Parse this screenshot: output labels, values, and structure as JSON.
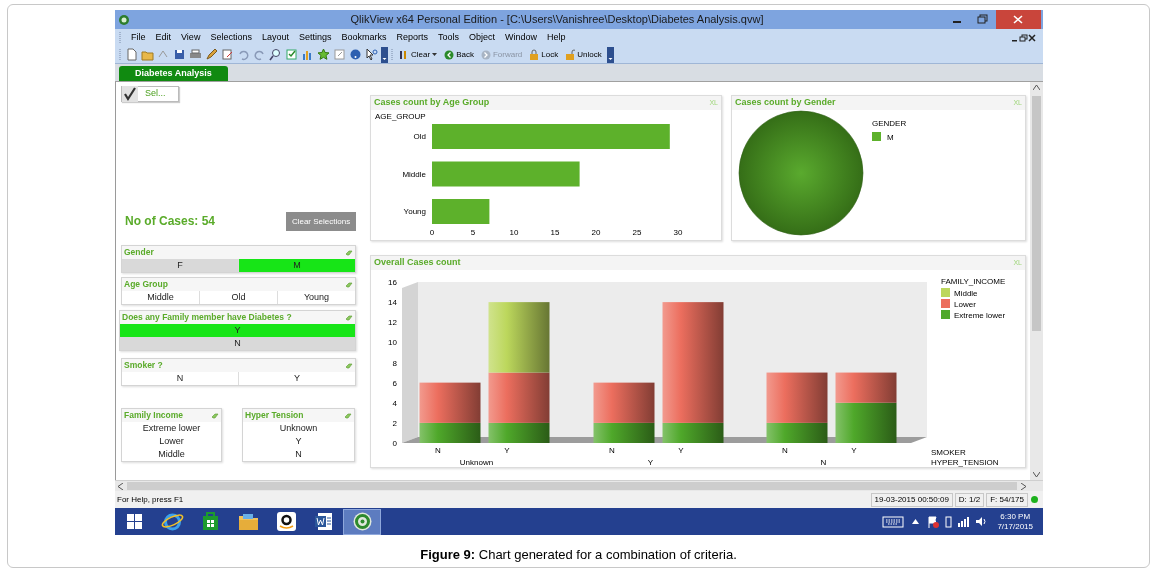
{
  "window": {
    "title": "QlikView x64 Personal Edition - [C:\\Users\\Vanishree\\Desktop\\Diabetes Analysis.qvw]"
  },
  "menu": [
    "File",
    "Edit",
    "View",
    "Selections",
    "Layout",
    "Settings",
    "Bookmarks",
    "Reports",
    "Tools",
    "Object",
    "Window",
    "Help"
  ],
  "toolbar": {
    "buttons": [
      {
        "kind": "clear",
        "label": "Clear",
        "disabled": false
      },
      {
        "kind": "back",
        "label": "Back",
        "disabled": false
      },
      {
        "kind": "forward",
        "label": "Forward",
        "disabled": true
      },
      {
        "kind": "lock",
        "label": "Lock",
        "disabled": false
      },
      {
        "kind": "unlock",
        "label": "Unlock",
        "disabled": false
      }
    ]
  },
  "tabs": [
    {
      "label": "Diabetes Analysis",
      "selected": true
    }
  ],
  "sheet": {
    "selections_button": "Sel...",
    "case_count": "No of Cases: 54",
    "clear_button": "Clear Selections",
    "listboxes": [
      {
        "title": "Gender",
        "kind": "row",
        "values": [
          {
            "label": "F",
            "selected": false,
            "excluded": true
          },
          {
            "label": "M",
            "selected": true,
            "excluded": false
          }
        ]
      },
      {
        "title": "Age Group",
        "kind": "row",
        "values": [
          {
            "label": "Middle",
            "selected": false,
            "excluded": false
          },
          {
            "label": "Old",
            "selected": false,
            "excluded": false
          },
          {
            "label": "Young",
            "selected": false,
            "excluded": false
          }
        ]
      },
      {
        "title": "Does any Family member have Diabetes ?",
        "kind": "column",
        "values": [
          {
            "label": "Y",
            "selected": true,
            "excluded": false
          },
          {
            "label": "N",
            "selected": false,
            "excluded": true
          }
        ]
      },
      {
        "title": "Smoker ?",
        "kind": "row",
        "values": [
          {
            "label": "N",
            "selected": false,
            "excluded": false
          },
          {
            "label": "Y",
            "selected": false,
            "excluded": false
          }
        ]
      },
      {
        "title": "Family Income",
        "kind": "column",
        "values": [
          {
            "label": "Extreme lower",
            "selected": false,
            "excluded": false
          },
          {
            "label": "Lower",
            "selected": false,
            "excluded": false
          },
          {
            "label": "Middle",
            "selected": false,
            "excluded": false
          }
        ]
      },
      {
        "title": "Hyper Tension",
        "kind": "column",
        "values": [
          {
            "label": "Unknown",
            "selected": false,
            "excluded": false
          },
          {
            "label": "Y",
            "selected": false,
            "excluded": false
          },
          {
            "label": "N",
            "selected": false,
            "excluded": false
          }
        ]
      }
    ],
    "charts": [
      {
        "export_label": "XL",
        "chart_data": {
          "type": "bar",
          "orientation": "horizontal",
          "title": "Cases count by Age Group",
          "ylabel": "AGE_GROUP",
          "categories": [
            "Old",
            "Middle",
            "Young"
          ],
          "values": [
            29,
            18,
            7
          ],
          "xlim": [
            0,
            30
          ],
          "xticks": [
            0,
            5,
            10,
            15,
            20,
            25,
            30
          ]
        }
      },
      {
        "export_label": "XL",
        "legend_title": "GENDER",
        "chart_data": {
          "type": "pie",
          "title": "Cases count by Gender",
          "categories": [
            "M"
          ],
          "values": [
            100
          ],
          "legend": true
        }
      },
      {
        "export_label": "XL",
        "legend_title": "FAMILY_INCOME",
        "x_groups": [
          "Unknown",
          "Y",
          "N"
        ],
        "group_axis_label": "HYPER_TENSION",
        "chart_data": {
          "type": "bar",
          "stacked": true,
          "title": "Overall Cases count",
          "xlabel": "SMOKER",
          "categories": [
            "N",
            "Y",
            "N",
            "Y",
            "N",
            "Y"
          ],
          "ylim": [
            0,
            16
          ],
          "yticks": [
            0,
            2,
            4,
            6,
            8,
            10,
            12,
            14,
            16
          ],
          "legend": true,
          "series": [
            {
              "name": "Extreme lower",
              "color": "#4fa82a",
              "values": [
                2,
                2,
                2,
                2,
                2,
                4
              ]
            },
            {
              "name": "Lower",
              "color": "#ec6e5e",
              "values": [
                4,
                5,
                4,
                12,
                5,
                3
              ]
            },
            {
              "name": "Middle",
              "color": "#bcd75c",
              "values": [
                null,
                7,
                null,
                null,
                null,
                null
              ]
            }
          ]
        }
      }
    ]
  },
  "status_bar": {
    "help": "For Help, press F1",
    "timestamp": "19-03-2015 00:50:09",
    "documents": "D: 1/2",
    "fields": "F: 54/175"
  },
  "taskbar": {
    "apps": [
      {
        "kind": "start",
        "selected": false
      },
      {
        "kind": "browser",
        "selected": false
      },
      {
        "kind": "store",
        "selected": false
      },
      {
        "kind": "files",
        "selected": false
      },
      {
        "kind": "amazon",
        "selected": false
      },
      {
        "kind": "word",
        "selected": false
      },
      {
        "kind": "qlikview",
        "selected": true
      }
    ],
    "time": "6:30 PM",
    "date": "7/17/2015"
  },
  "caption": "**Figure 9:** Chart generated for a combination of criteria."
}
